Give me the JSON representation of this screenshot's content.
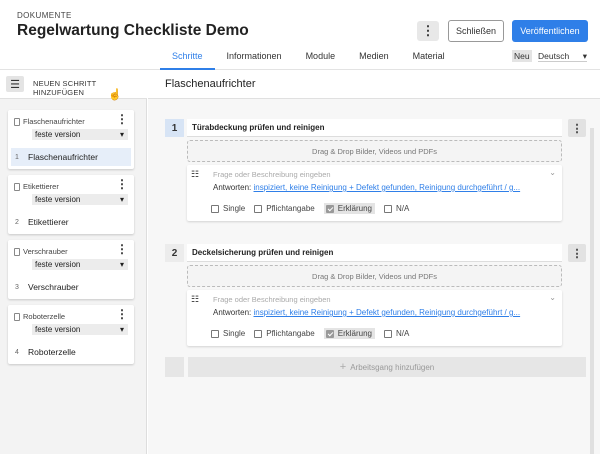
{
  "header": {
    "section_label": "DOKUMENTE",
    "title": "Regelwartung Checkliste Demo",
    "more_icon": "kebab-icon",
    "close_label": "Schließen",
    "publish_label": "Veröffentlichen",
    "accent_color": "#2f7fe8"
  },
  "tabs": [
    {
      "label": "Schritte",
      "active": true
    },
    {
      "label": "Informationen",
      "active": false
    },
    {
      "label": "Module",
      "active": false
    },
    {
      "label": "Medien",
      "active": false
    },
    {
      "label": "Material",
      "active": false
    }
  ],
  "language": {
    "badge": "Neu",
    "selected": "Deutsch"
  },
  "sidebar": {
    "add_step_label": "NEUEN SCHRITT HINZUFÜGEN",
    "steps": [
      {
        "head": "Flaschenaufrichter",
        "version": "feste version",
        "num": "1",
        "name": "Flaschenaufrichter",
        "active": true
      },
      {
        "head": "Etikettierer",
        "version": "feste version",
        "num": "2",
        "name": "Etikettierer",
        "active": false
      },
      {
        "head": "Verschrauber",
        "version": "feste version",
        "num": "3",
        "name": "Verschrauber",
        "active": false
      },
      {
        "head": "Roboterzelle",
        "version": "feste version",
        "num": "4",
        "name": "Roboterzelle",
        "active": false
      }
    ]
  },
  "main": {
    "title": "Flaschenaufrichter",
    "operations": [
      {
        "num": "1",
        "title": "Türabdeckung prüfen und reinigen",
        "dropzone": "Drag & Drop Bilder, Videos und PDFs",
        "question_placeholder": "Frage oder Beschreibung eingeben",
        "answers_label": "Antworten:",
        "answers_value": "inspiziert, keine Reinigung + Defekt gefunden, Reinigung durchgeführt / g...",
        "options": [
          {
            "label": "Single",
            "checked": false
          },
          {
            "label": "Pflichtangabe",
            "checked": false
          },
          {
            "label": "Erklärung",
            "checked": true
          },
          {
            "label": "N/A",
            "checked": false
          }
        ]
      },
      {
        "num": "2",
        "title": "Deckelsicherung prüfen und reinigen",
        "dropzone": "Drag & Drop Bilder, Videos und PDFs",
        "question_placeholder": "Frage oder Beschreibung eingeben",
        "answers_label": "Antworten:",
        "answers_value": "inspiziert, keine Reinigung + Defekt gefunden, Reinigung durchgeführt / g...",
        "options": [
          {
            "label": "Single",
            "checked": false
          },
          {
            "label": "Pflichtangabe",
            "checked": false
          },
          {
            "label": "Erklärung",
            "checked": true
          },
          {
            "label": "N/A",
            "checked": false
          }
        ]
      }
    ],
    "add_operation_label": "Arbeitsgang hinzufügen"
  }
}
